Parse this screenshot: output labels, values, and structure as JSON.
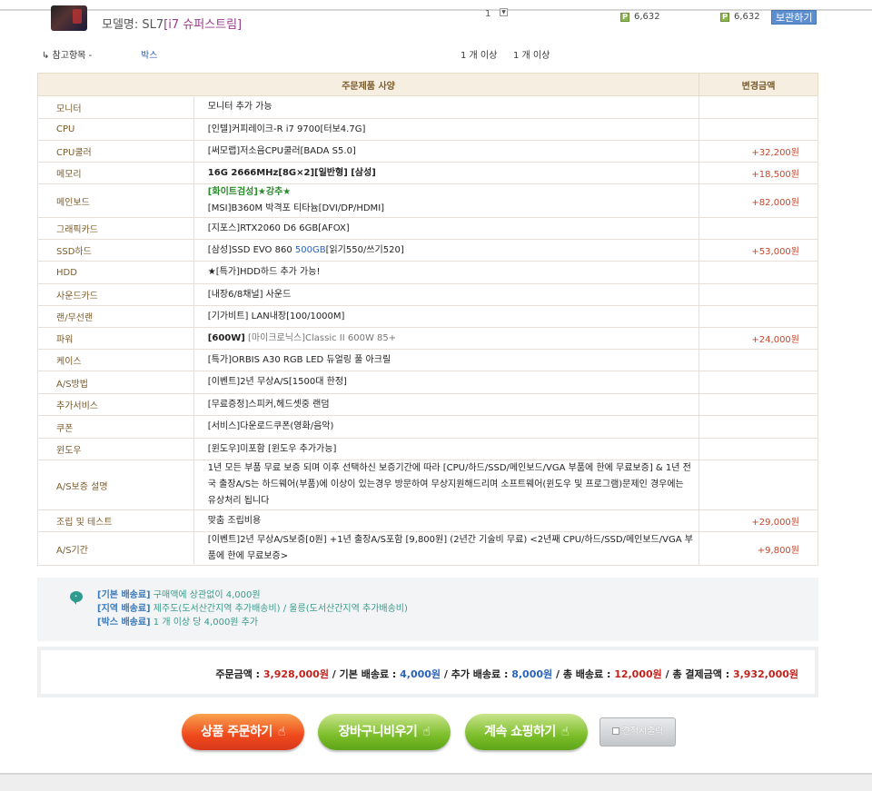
{
  "product": {
    "model_label": "모델명: SL7",
    "model_name": "[i7 슈퍼스트림]",
    "qty": "1",
    "qty_select_icon": "chevron-down-icon",
    "points1": "6,632",
    "points2": "6,632",
    "wish_button": "보관하기"
  },
  "reference": {
    "label": "↳ 참고항목 -",
    "box": "박스",
    "qty1": "1 개 이상",
    "qty2": "1 개 이상"
  },
  "spec_table": {
    "header_spec": "주문제품 사양",
    "header_price": "변경금액",
    "rows": [
      {
        "label": "모니터",
        "value": "모니터 추가 가능",
        "price": ""
      },
      {
        "label": "CPU",
        "value": "[인텔]커피레이크-R i7 9700[터보4.7G]",
        "price": ""
      },
      {
        "label": "CPU쿨러",
        "value": "[써모랩]저소음CPU쿨러[BADA S5.0]",
        "price": "+32,200원"
      },
      {
        "label": "메모리",
        "value": "16G 2666MHz[8G×2][일반형] [삼성]",
        "price": "+18,500원"
      },
      {
        "label": "메인보드",
        "value_highlight": "[화이트검성]★강추★",
        "value": "[MSI]B360M 박격포 티타늄[DVI/DP/HDMI]",
        "price": "+82,000원"
      },
      {
        "label": "그래픽카드",
        "value": "[지포스]RTX2060 D6 6GB[AFOX]",
        "price": ""
      },
      {
        "label": "SSD하드",
        "value_pre": "[삼성]SSD EVO 860 ",
        "value_blue": "500GB",
        "value_post": "[읽기550/쓰기520]",
        "price": "+53,000원"
      },
      {
        "label": "HDD",
        "value": "★[특가]HDD하드 추가 가능!",
        "price": ""
      },
      {
        "label": "사운드카드",
        "value": "[내장6/8채널] 사운드",
        "price": ""
      },
      {
        "label": "랜/무선랜",
        "value": "[기가비트] LAN내장[100/1000M]",
        "price": ""
      },
      {
        "label": "파워",
        "value_bold": "[600W]",
        "value": " [마이크로닉스]Classic II 600W 85+",
        "price": "+24,000원"
      },
      {
        "label": "케이스",
        "value": "[특가]ORBIS A30 RGB LED 듀얼링 풀 아크릴",
        "price": ""
      },
      {
        "label": "A/S방법",
        "value": "[이벤트]2년 무상A/S[1500대 한정]",
        "price": ""
      },
      {
        "label": "추가서비스",
        "value": "[무료증정]스피커,헤드셋중 랜덤",
        "price": ""
      },
      {
        "label": "쿠폰",
        "value": "[서비스]다운로드쿠폰(영화/음악)",
        "price": ""
      },
      {
        "label": "윈도우",
        "value": "[윈도우]미포함 [윈도우 추가가능]",
        "price": ""
      },
      {
        "label": "A/S보증 설명",
        "value": "1년 모든 부품 무료 보증 되며 이후 선택하신 보증기간에 따라 [CPU/하드/SSD/메인보드/VGA 부품에 한에 무료보증] & 1년 전국 출장A/S는 하드웨어(부품)에 이상이 있는경우 방문하여 무상지원해드리며 소프트웨어(윈도우 및 프로그램)문제인 경우에는 유상처리 됩니다",
        "price": ""
      },
      {
        "label": "조립 및 테스트",
        "value": "맞춤 조립비용",
        "price": "+29,000원"
      },
      {
        "label": "A/S기간",
        "value": "[이벤트]2년 무상A/S보증[0원] +1년 출장A/S포함 [9,800원] (2년간 기술비 무료) <2년째 CPU/하드/SSD/메인보드/VGA 부품에 한에 무료보증>",
        "price": "+9,800원"
      }
    ]
  },
  "shipping": {
    "lines": [
      {
        "key": "[기본 배송료]",
        "val": " 구매액에 상관없이 4,000원"
      },
      {
        "key": "[지역 배송료]",
        "val": " 제주도(도서산간지역 추가배송비) / 울릉(도서산간지역 추가배송비)"
      },
      {
        "key": "[박스 배송료]",
        "val": " 1 개 이상 당 4,000원 추가"
      }
    ]
  },
  "totals": {
    "order_label": "주문금액 : ",
    "order_amount": "3,928,000원",
    "base_label": " / 기본 배송료 : ",
    "base_amount": "4,000원",
    "extra_label": " / 추가 배송료 : ",
    "extra_amount": "8,000원",
    "ship_total_label": " / 총 배송료 : ",
    "ship_total_amount": "12,000원",
    "grand_label": " / 총 결제금액 : ",
    "grand_amount": "3,932,000원"
  },
  "buttons": {
    "order": "상품 주문하기",
    "empty_cart": "장바구니비우기",
    "continue": "계속 쇼핑하기",
    "quote": "견적서출력",
    "hand_icon": "☝"
  },
  "colors": {
    "order_button": "#ef4a1d",
    "green_button": "#7cbe2a",
    "table_header_bg": "#f6efe1",
    "price_text": "#c5452a",
    "total_red": "#c0221c"
  }
}
